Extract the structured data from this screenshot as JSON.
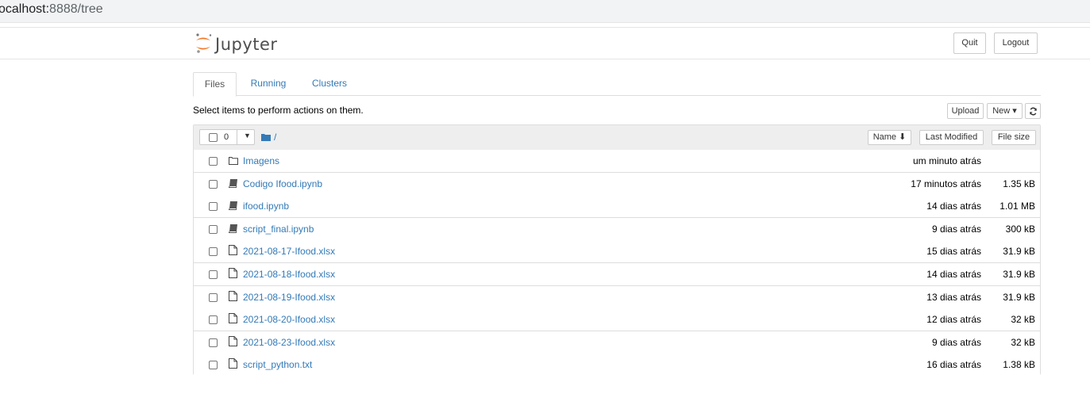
{
  "browser": {
    "url_host": "ocalhost:",
    "url_rest": "8888/tree"
  },
  "header": {
    "logo_text": "Jupyter",
    "quit_label": "Quit",
    "logout_label": "Logout"
  },
  "tabs": [
    {
      "label": "Files",
      "active": true
    },
    {
      "label": "Running",
      "active": false
    },
    {
      "label": "Clusters",
      "active": false
    }
  ],
  "toolbar": {
    "hint": "Select items to perform actions on them.",
    "upload_label": "Upload",
    "new_label": "New ▾",
    "refresh_icon": "refresh-icon"
  },
  "list_header": {
    "selected_count": "0",
    "breadcrumb": "/",
    "sort_name_label": "Name ⬇",
    "sort_modified_label": "Last Modified",
    "sort_size_label": "File size"
  },
  "files": [
    {
      "name": "Imagens",
      "type": "folder",
      "modified": "um minuto atrás",
      "size": ""
    },
    {
      "name": "Codigo Ifood.ipynb",
      "type": "notebook",
      "modified": "17 minutos atrás",
      "size": "1.35 kB"
    },
    {
      "name": "ifood.ipynb",
      "type": "notebook",
      "modified": "14 dias atrás",
      "size": "1.01 MB"
    },
    {
      "name": "script_final.ipynb",
      "type": "notebook",
      "modified": "9 dias atrás",
      "size": "300 kB"
    },
    {
      "name": "2021-08-17-Ifood.xlsx",
      "type": "file",
      "modified": "15 dias atrás",
      "size": "31.9 kB"
    },
    {
      "name": "2021-08-18-Ifood.xlsx",
      "type": "file",
      "modified": "14 dias atrás",
      "size": "31.9 kB"
    },
    {
      "name": "2021-08-19-Ifood.xlsx",
      "type": "file",
      "modified": "13 dias atrás",
      "size": "31.9 kB"
    },
    {
      "name": "2021-08-20-Ifood.xlsx",
      "type": "file",
      "modified": "12 dias atrás",
      "size": "32 kB"
    },
    {
      "name": "2021-08-23-Ifood.xlsx",
      "type": "file",
      "modified": "9 dias atrás",
      "size": "32 kB"
    },
    {
      "name": "script_python.txt",
      "type": "file",
      "modified": "16 dias atrás",
      "size": "1.38 kB"
    }
  ],
  "colors": {
    "link": "#337ab7",
    "jupyter_orange": "#f37726"
  }
}
